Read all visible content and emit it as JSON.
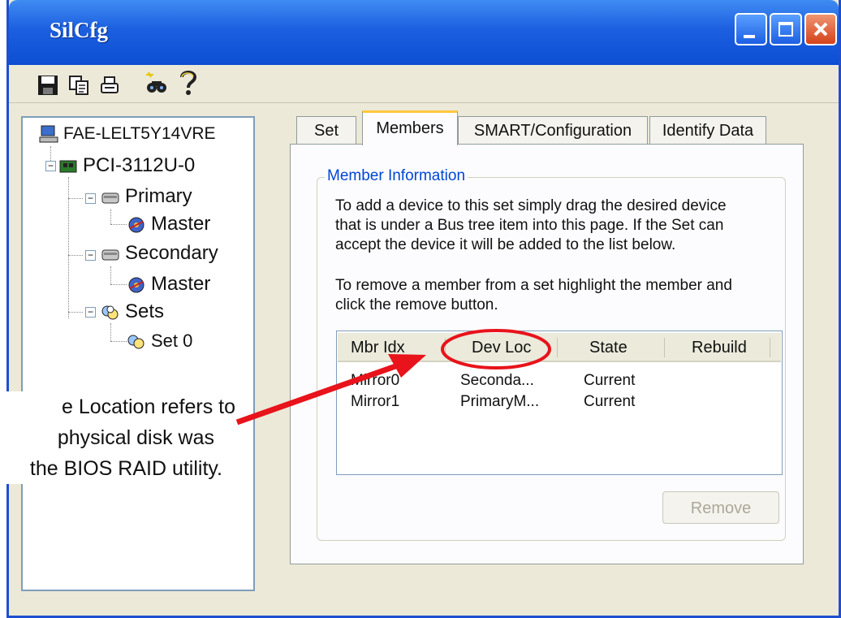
{
  "window": {
    "title": "SilCfg",
    "title_color": "#ffffff",
    "titlebar_color": "#1c5fe0"
  },
  "toolbar": {
    "icons": [
      "save-icon",
      "copy-icon",
      "print-icon",
      "find-icon",
      "help-icon"
    ]
  },
  "tree": {
    "root": "FAE-LELT5Y14VRE",
    "controller": "PCI-3112U-0",
    "primary": "Primary",
    "primary_master": "Master",
    "secondary": "Secondary",
    "secondary_master": "Master",
    "sets": "Sets",
    "set0": "Set 0"
  },
  "tabs": {
    "set": "Set",
    "members": "Members",
    "smart": "SMART/Configuration",
    "identify": "Identify Data",
    "active": "Members"
  },
  "member_info": {
    "group_label": "Member Information",
    "para1_line1": "To add a device to this set simply drag the desired device",
    "para1_line2": "that is under a Bus tree item into this page.  If the Set can",
    "para1_line3": "accept the device it will be added to the list below.",
    "para2_line1": "To remove a member from a set highlight the member and",
    "para2_line2": "click the remove button."
  },
  "list": {
    "columns": [
      "Mbr Idx",
      "Dev Loc",
      "State",
      "Rebuild"
    ],
    "rows": [
      {
        "mbr_idx": "Mirror0",
        "dev_loc": "Seconda...",
        "state": "Current",
        "rebuild": ""
      },
      {
        "mbr_idx": "Mirror1",
        "dev_loc": "PrimaryM...",
        "state": "Current",
        "rebuild": ""
      }
    ]
  },
  "buttons": {
    "remove": "Remove"
  },
  "annotation": {
    "line1": "e  Location  refers  to",
    "line2": "physical  disk  was",
    "line3": "the BIOS RAID utility.",
    "arrow_color": "#e8131b"
  }
}
